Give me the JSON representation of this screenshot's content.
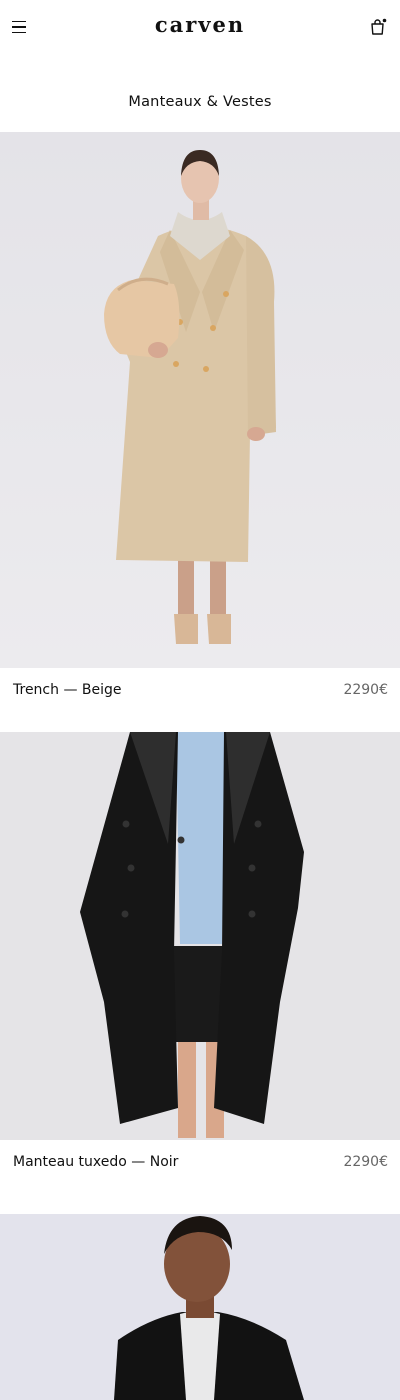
{
  "header": {
    "brand": "carven",
    "menu_icon": "menu-icon",
    "bag_icon": "shopping-bag-icon"
  },
  "page": {
    "title": "Manteaux & Vestes"
  },
  "products": [
    {
      "name": "Trench — Beige",
      "price": "2290€",
      "image": "model-beige-trench-coat"
    },
    {
      "name": "Manteau tuxedo — Noir",
      "price": "2290€",
      "image": "black-tuxedo-coat"
    },
    {
      "name": "",
      "price": "",
      "image": "model-black-jacket"
    }
  ]
}
